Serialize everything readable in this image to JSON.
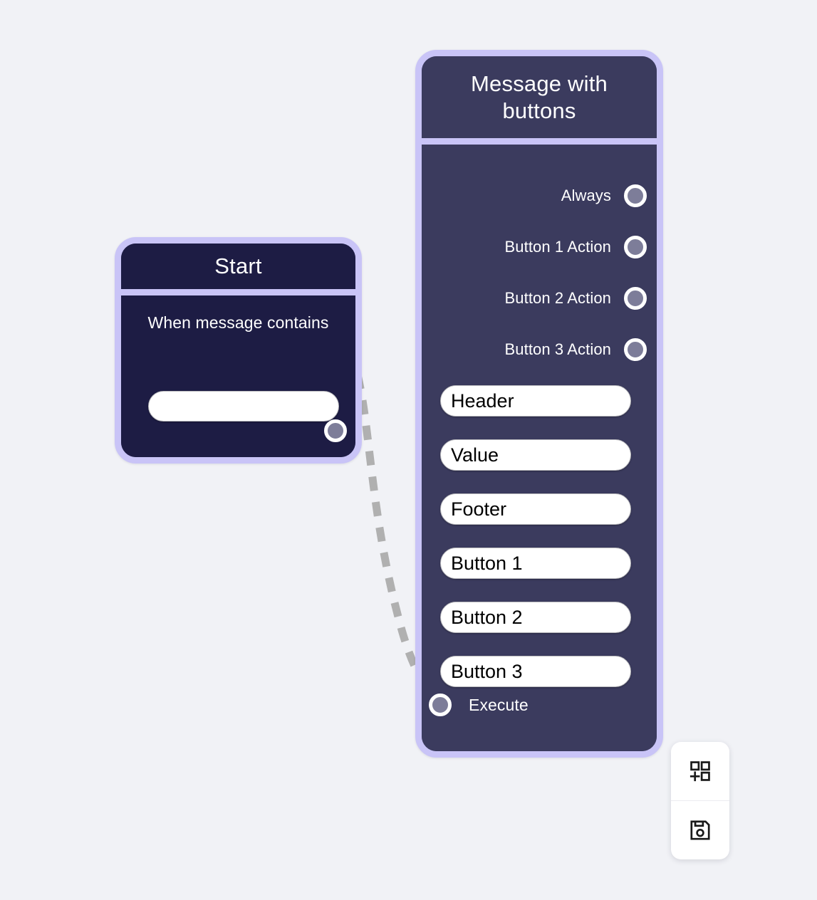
{
  "canvas": {
    "background_color": "#f1f2f6",
    "node_border_color": "#c9c4f7",
    "handle_color": "#7d7d99",
    "edge_color": "#b0b0b0"
  },
  "start_node": {
    "title": "Start",
    "condition_label": "When message contains",
    "text_input_value": "",
    "text_input_placeholder": "",
    "output_handle_name": "start-output"
  },
  "message_node": {
    "title": "Message with buttons",
    "outputs": [
      {
        "label": "Always"
      },
      {
        "label": "Button 1 Action"
      },
      {
        "label": "Button 2 Action"
      },
      {
        "label": "Button 3 Action"
      }
    ],
    "fields": [
      {
        "label": "Header",
        "value": "Header"
      },
      {
        "label": "Value",
        "value": "Value"
      },
      {
        "label": "Footer",
        "value": "Footer"
      },
      {
        "label": "Button 1",
        "value": "Button 1"
      },
      {
        "label": "Button 2",
        "value": "Button 2"
      },
      {
        "label": "Button 3",
        "value": "Button 3"
      }
    ],
    "execute_label": "Execute"
  },
  "toolbar": {
    "add_node_icon": "add-module-icon",
    "save_icon": "save-floppy-icon"
  }
}
